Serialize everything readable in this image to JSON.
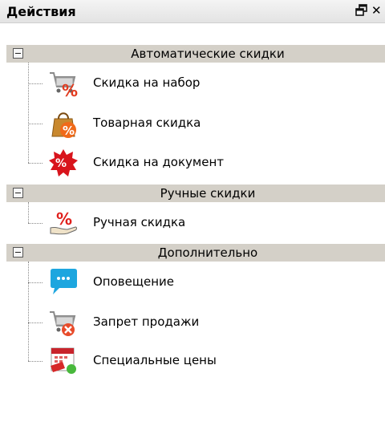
{
  "panel": {
    "title": "Действия"
  },
  "groups": [
    {
      "label": "Автоматические скидки",
      "items": [
        {
          "label": "Скидка на набор",
          "icon": "cart-percent-icon"
        },
        {
          "label": "Товарная скидка",
          "icon": "bag-percent-icon"
        },
        {
          "label": "Скидка на документ",
          "icon": "starburst-percent-icon"
        }
      ]
    },
    {
      "label": "Ручные скидки",
      "items": [
        {
          "label": "Ручная скидка",
          "icon": "hand-percent-icon"
        }
      ]
    },
    {
      "label": "Дополнительно",
      "items": [
        {
          "label": "Оповещение",
          "icon": "speech-bubble-icon"
        },
        {
          "label": "Запрет продажи",
          "icon": "cart-prohibited-icon"
        },
        {
          "label": "Специальные цены",
          "icon": "calendar-price-tag-icon"
        }
      ]
    }
  ]
}
